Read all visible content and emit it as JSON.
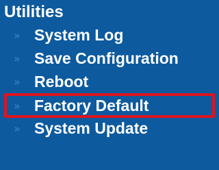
{
  "colors": {
    "background": "#0d5a9e",
    "text": "#ffffff",
    "arrow": "#3f86c4",
    "highlight_border": "#e0141e"
  },
  "sidebar": {
    "title": "Utilities",
    "arrow_glyph": "»",
    "items": [
      {
        "label": "System Log",
        "icon": "double-chevron-right-icon"
      },
      {
        "label": "Save Configuration",
        "icon": "double-chevron-right-icon"
      },
      {
        "label": "Reboot",
        "icon": "double-chevron-right-icon"
      },
      {
        "label": "Factory Default",
        "icon": "double-chevron-right-icon",
        "highlighted": true
      },
      {
        "label": "System Update",
        "icon": "double-chevron-right-icon"
      }
    ]
  }
}
